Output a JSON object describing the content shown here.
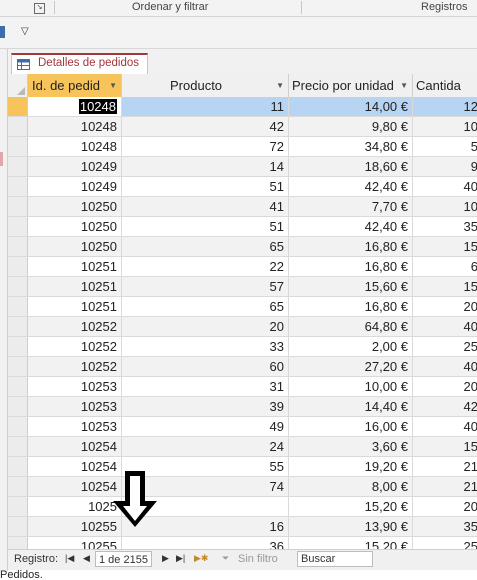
{
  "ribbon": {
    "group_sort_filter": "Ordenar y filtrar",
    "group_records": "Registros"
  },
  "tab": {
    "label": "Detalles de pedidos"
  },
  "columns": [
    {
      "label": "Id. de pedid"
    },
    {
      "label": "Producto"
    },
    {
      "label": "Precio por unidad"
    },
    {
      "label": "Cantida"
    }
  ],
  "rows": [
    {
      "id": "10248",
      "producto": "11",
      "precio": "14,00 €",
      "cantidad": "12"
    },
    {
      "id": "10248",
      "producto": "42",
      "precio": "9,80 €",
      "cantidad": "10"
    },
    {
      "id": "10248",
      "producto": "72",
      "precio": "34,80 €",
      "cantidad": "5"
    },
    {
      "id": "10249",
      "producto": "14",
      "precio": "18,60 €",
      "cantidad": "9"
    },
    {
      "id": "10249",
      "producto": "51",
      "precio": "42,40 €",
      "cantidad": "40"
    },
    {
      "id": "10250",
      "producto": "41",
      "precio": "7,70 €",
      "cantidad": "10"
    },
    {
      "id": "10250",
      "producto": "51",
      "precio": "42,40 €",
      "cantidad": "35"
    },
    {
      "id": "10250",
      "producto": "65",
      "precio": "16,80 €",
      "cantidad": "15"
    },
    {
      "id": "10251",
      "producto": "22",
      "precio": "16,80 €",
      "cantidad": "6"
    },
    {
      "id": "10251",
      "producto": "57",
      "precio": "15,60 €",
      "cantidad": "15"
    },
    {
      "id": "10251",
      "producto": "65",
      "precio": "16,80 €",
      "cantidad": "20"
    },
    {
      "id": "10252",
      "producto": "20",
      "precio": "64,80 €",
      "cantidad": "40"
    },
    {
      "id": "10252",
      "producto": "33",
      "precio": "2,00 €",
      "cantidad": "25"
    },
    {
      "id": "10252",
      "producto": "60",
      "precio": "27,20 €",
      "cantidad": "40"
    },
    {
      "id": "10253",
      "producto": "31",
      "precio": "10,00 €",
      "cantidad": "20"
    },
    {
      "id": "10253",
      "producto": "39",
      "precio": "14,40 €",
      "cantidad": "42"
    },
    {
      "id": "10253",
      "producto": "49",
      "precio": "16,00 €",
      "cantidad": "40"
    },
    {
      "id": "10254",
      "producto": "24",
      "precio": "3,60 €",
      "cantidad": "15"
    },
    {
      "id": "10254",
      "producto": "55",
      "precio": "19,20 €",
      "cantidad": "21"
    },
    {
      "id": "10254",
      "producto": "74",
      "precio": "8,00 €",
      "cantidad": "21"
    },
    {
      "id": "1025",
      "producto": "",
      "precio": "15,20 €",
      "cantidad": "20"
    },
    {
      "id": "10255",
      "producto": "16",
      "precio": "13,90 €",
      "cantidad": "35"
    },
    {
      "id": "10255",
      "producto": "36",
      "precio": "15,20 €",
      "cantidad": "25"
    }
  ],
  "navigator": {
    "label": "Registro:",
    "record": "1 de 2155",
    "filter": "Sin filtro",
    "search": "Buscar"
  },
  "status_text": "Pedidos.",
  "colors": {
    "accent": "#a4373a",
    "selected_row": "#b7d5f2",
    "active_header": "#f7c45c"
  }
}
